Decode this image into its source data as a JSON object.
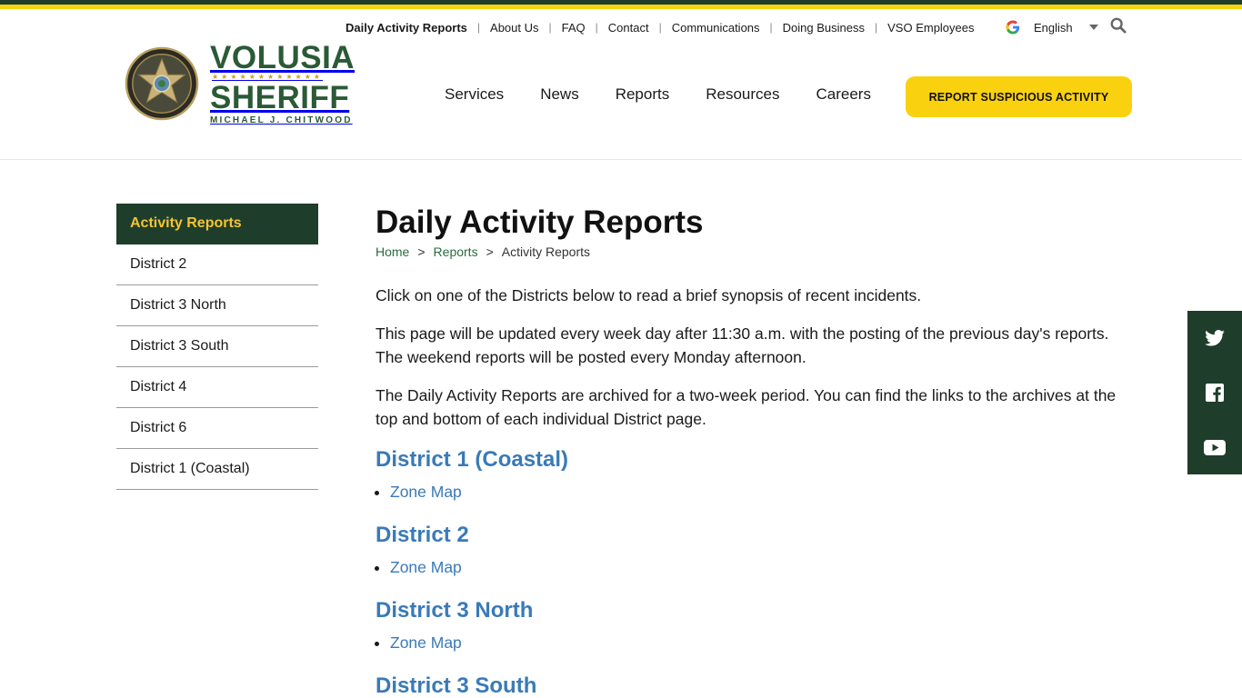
{
  "utility_nav": [
    {
      "label": "Daily Activity Reports",
      "active": true
    },
    {
      "label": "About Us"
    },
    {
      "label": "FAQ"
    },
    {
      "label": "Contact"
    },
    {
      "label": "Communications"
    },
    {
      "label": "Doing Business"
    },
    {
      "label": "VSO Employees"
    }
  ],
  "language": {
    "selected": "English",
    "icon": "google-icon"
  },
  "search": {
    "icon": "search-icon"
  },
  "logo": {
    "line1": "VOLUSIA",
    "stars": "★★★★★★★★★★★★",
    "line2": "SHERIFF",
    "line3": "MICHAEL J. CHITWOOD"
  },
  "main_nav": [
    "Services",
    "News",
    "Reports",
    "Resources",
    "Careers"
  ],
  "cta_label": "REPORT SUSPICIOUS ACTIVITY",
  "sidebar": [
    {
      "label": "Activity Reports",
      "active": true
    },
    {
      "label": "District 2"
    },
    {
      "label": "District 3 North"
    },
    {
      "label": "District 3 South"
    },
    {
      "label": "District 4"
    },
    {
      "label": "District 6"
    },
    {
      "label": "District 1 (Coastal)"
    }
  ],
  "page": {
    "title": "Daily Activity Reports",
    "breadcrumb": {
      "home": "Home",
      "sep": ">",
      "reports": "Reports",
      "current": "Activity Reports"
    },
    "paragraphs": [
      "Click on one of the Districts below to read a brief synopsis of recent incidents.",
      "This page will be updated every week day after 11:30 a.m. with the posting of the previous day's reports. The weekend reports will be posted every Monday afternoon.",
      "The Daily Activity Reports are archived for a two-week period. You can find the links to the archives at the top and bottom of each individual District page."
    ],
    "districts": [
      {
        "title": "District 1 (Coastal)",
        "link": "Zone Map"
      },
      {
        "title": "District 2",
        "link": "Zone Map"
      },
      {
        "title": "District 3 North",
        "link": "Zone Map"
      },
      {
        "title": "District 3 South"
      }
    ]
  },
  "social": [
    "twitter-icon",
    "facebook-icon",
    "youtube-icon"
  ],
  "colors": {
    "dark_green": "#1f3d2b",
    "yellow": "#f9d10e",
    "link_blue": "#3a7ab8",
    "breadcrumb_green": "#2b6b3f"
  }
}
